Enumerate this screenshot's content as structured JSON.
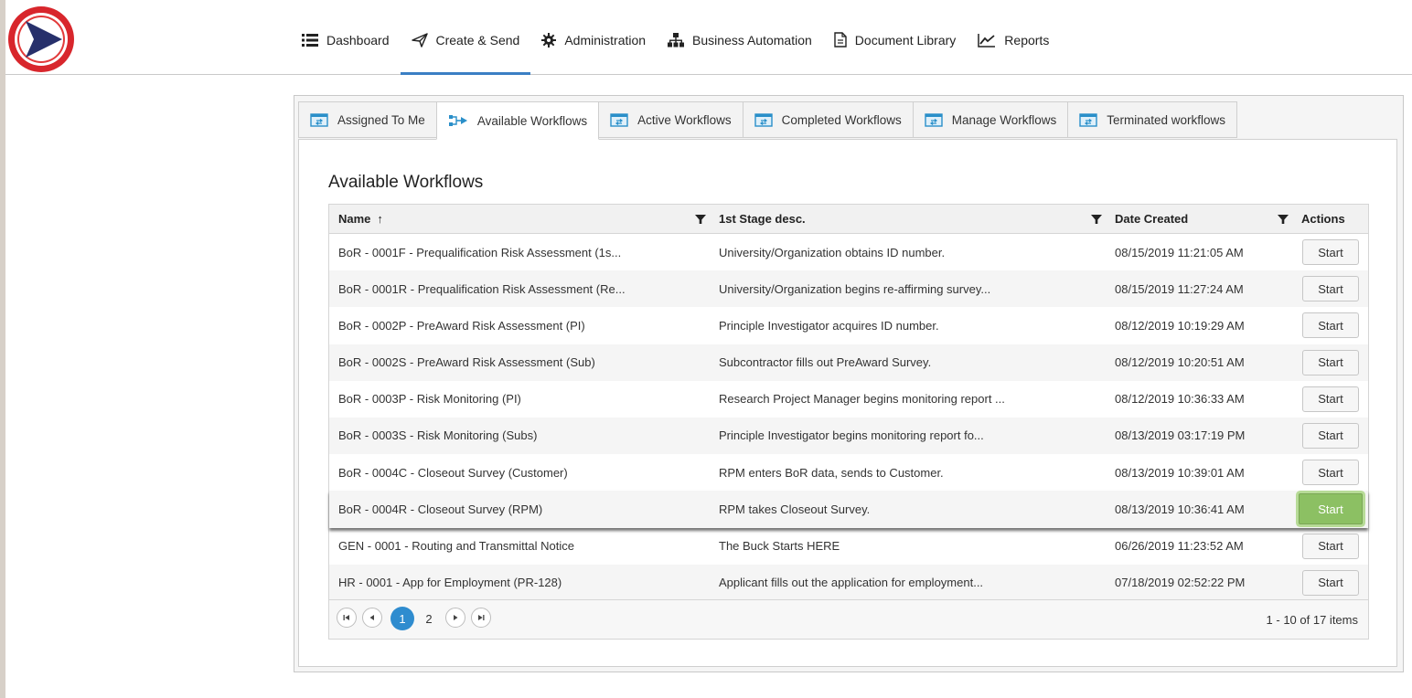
{
  "nav": {
    "items": [
      {
        "label": "Dashboard",
        "icon": "list-icon"
      },
      {
        "label": "Create & Send",
        "icon": "send-icon",
        "active": true
      },
      {
        "label": "Administration",
        "icon": "gear-icon"
      },
      {
        "label": "Business Automation",
        "icon": "org-chart-icon"
      },
      {
        "label": "Document Library",
        "icon": "document-icon"
      },
      {
        "label": "Reports",
        "icon": "line-chart-icon"
      }
    ]
  },
  "tabs": [
    {
      "label": "Assigned To Me"
    },
    {
      "label": "Available Workflows",
      "active": true
    },
    {
      "label": "Active Workflows"
    },
    {
      "label": "Completed Workflows"
    },
    {
      "label": "Manage Workflows"
    },
    {
      "label": "Terminated workflows"
    }
  ],
  "heading": "Available Workflows",
  "grid": {
    "columns": {
      "name": "Name",
      "desc": "1st Stage desc.",
      "date": "Date Created",
      "actions": "Actions"
    },
    "sort_indicator": "↑",
    "rows": [
      {
        "name": "BoR - 0001F - Prequalification Risk Assessment (1s...",
        "desc": "University/Organization obtains ID number.",
        "date": "08/15/2019 11:21:05 AM",
        "action": "Start"
      },
      {
        "name": "BoR - 0001R - Prequalification Risk Assessment (Re...",
        "desc": "University/Organization begins re-affirming survey...",
        "date": "08/15/2019 11:27:24 AM",
        "action": "Start"
      },
      {
        "name": "BoR - 0002P - PreAward Risk Assessment (PI)",
        "desc": "Principle Investigator acquires ID number.",
        "date": "08/12/2019 10:19:29 AM",
        "action": "Start"
      },
      {
        "name": "BoR - 0002S - PreAward Risk Assessment (Sub)",
        "desc": "Subcontractor fills out PreAward Survey.",
        "date": "08/12/2019 10:20:51 AM",
        "action": "Start"
      },
      {
        "name": "BoR - 0003P - Risk Monitoring (PI)",
        "desc": "Research Project Manager begins monitoring report ...",
        "date": "08/12/2019 10:36:33 AM",
        "action": "Start"
      },
      {
        "name": "BoR - 0003S - Risk Monitoring (Subs)",
        "desc": "Principle Investigator begins monitoring report fo...",
        "date": "08/13/2019 03:17:19 PM",
        "action": "Start"
      },
      {
        "name": "BoR - 0004C - Closeout Survey (Customer)",
        "desc": "RPM enters BoR data, sends to Customer.",
        "date": "08/13/2019 10:39:01 AM",
        "action": "Start"
      },
      {
        "name": "BoR - 0004R - Closeout Survey (RPM)",
        "desc": "RPM takes Closeout Survey.",
        "date": "08/13/2019 10:36:41 AM",
        "action": "Start",
        "hover": true
      },
      {
        "name": "GEN - 0001 - Routing and Transmittal Notice",
        "desc": "The Buck Starts HERE",
        "date": "06/26/2019 11:23:52 AM",
        "action": "Start"
      },
      {
        "name": "HR - 0001 - App for Employment (PR-128)",
        "desc": "Applicant fills out the application for employment...",
        "date": "07/18/2019 02:52:22 PM",
        "action": "Start"
      }
    ]
  },
  "pager": {
    "pages": [
      "1",
      "2"
    ],
    "current": "1",
    "info": "1 - 10 of 17 items"
  },
  "colors": {
    "accent": "#3b7fc4",
    "pager_current": "#2f8ccf",
    "start_hover": "#8cc063",
    "logo_red": "#d8262c",
    "logo_navy": "#27306b"
  }
}
